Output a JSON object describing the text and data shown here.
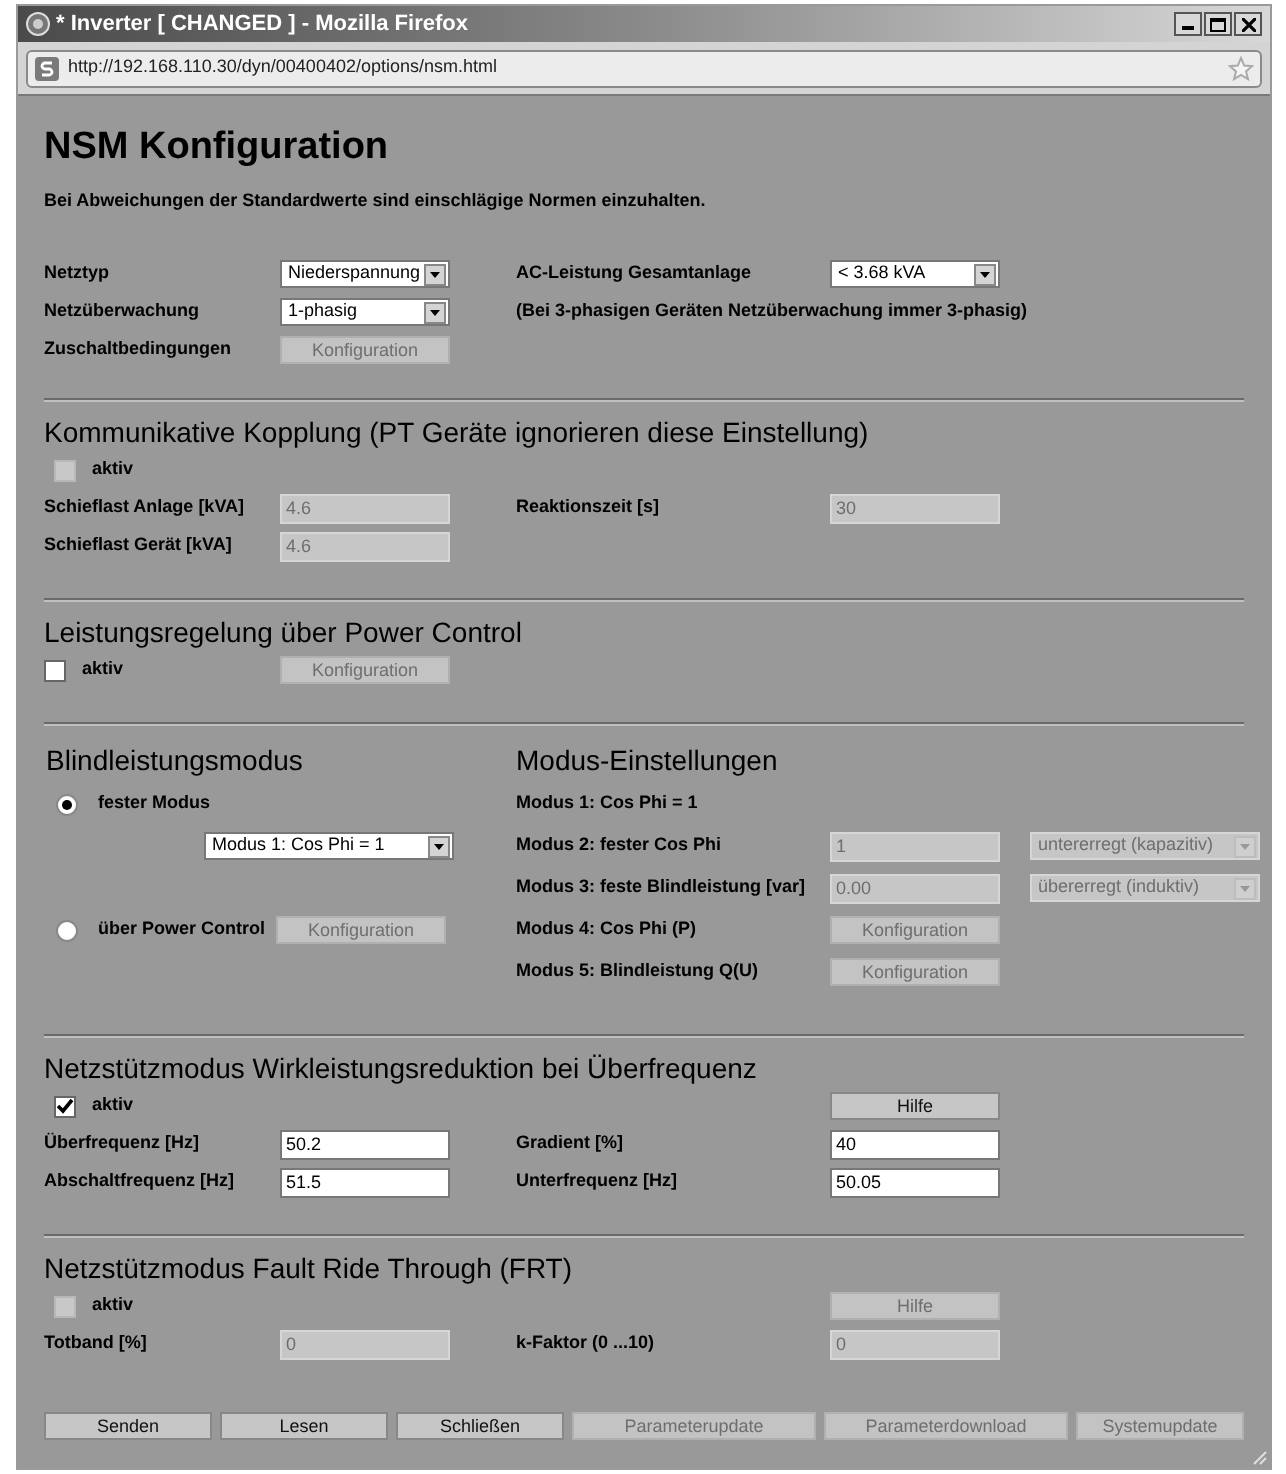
{
  "window": {
    "title": "* Inverter [ CHANGED ] - Mozilla Firefox",
    "url": "http://192.168.110.30/dyn/00400402/options/nsm.html"
  },
  "heading": "NSM Konfiguration",
  "note": "Bei Abweichungen der Standardwerte sind einschlägige Normen einzuhalten.",
  "sections": [
    {
      "kind": "plain",
      "rows": [
        {
          "kind": "field",
          "label": "Netztyp",
          "control": {
            "kind": "select",
            "value": "Niederspannung",
            "disabled": false
          },
          "label2": "AC-Leistung Gesamtanlage",
          "control2": {
            "kind": "select",
            "value": "< 3.68 kVA",
            "disabled": false
          }
        },
        {
          "kind": "field",
          "label": "Netzüberwachung",
          "control": {
            "kind": "select",
            "value": "1-phasig",
            "disabled": false
          },
          "note": "(Bei 3-phasigen Geräten Netzüberwachung immer 3-phasig)"
        },
        {
          "kind": "field",
          "label": "Zuschaltbedingungen",
          "control": {
            "kind": "button",
            "label": "Konfiguration",
            "disabled": true
          }
        }
      ]
    },
    {
      "kind": "plain",
      "title": "Kommunikative Kopplung (PT Geräte ignorieren diese Einstellung)",
      "rows": [
        {
          "kind": "check",
          "checkbox": {
            "label": "aktiv",
            "checked": false,
            "disabled": true
          }
        },
        {
          "kind": "field",
          "label": "Schieflast Anlage [kVA]",
          "control": {
            "kind": "input",
            "value": "4.6",
            "disabled": true
          },
          "label2": "Reaktionszeit [s]",
          "control2": {
            "kind": "input",
            "value": "30",
            "disabled": true
          }
        },
        {
          "kind": "field",
          "label": "Schieflast Gerät [kVA]",
          "control": {
            "kind": "input",
            "value": "4.6",
            "disabled": true
          }
        }
      ]
    },
    {
      "kind": "plain",
      "title": "Leistungsregelung über Power Control",
      "rows": [
        {
          "kind": "field",
          "checkbox": {
            "label": "aktiv",
            "checked": false,
            "disabled": false
          },
          "control": {
            "kind": "button",
            "label": "Konfiguration",
            "disabled": true
          }
        }
      ]
    },
    {
      "kind": "split",
      "left": {
        "title": "Blindleistungsmodus",
        "rows": [
          {
            "kind": "radio",
            "label": "fester Modus",
            "selected": true
          },
          {
            "kind": "select_row",
            "control": {
              "kind": "select",
              "value": "Modus 1: Cos Phi = 1",
              "disabled": false
            }
          },
          {
            "kind": "empty"
          },
          {
            "kind": "radio",
            "label": "über Power Control",
            "selected": false,
            "control": {
              "kind": "button",
              "label": "Konfiguration",
              "disabled": true
            }
          }
        ]
      },
      "right": {
        "title": "Modus-Einstellungen",
        "rows": [
          {
            "kind": "field",
            "label2": "Modus 1: Cos Phi = 1"
          },
          {
            "kind": "field",
            "label2": "Modus 2: fester Cos Phi",
            "control2": {
              "kind": "input",
              "value": "1",
              "disabled": true
            },
            "control3": {
              "kind": "select",
              "value": "untererregt (kapazitiv)",
              "disabled": true
            }
          },
          {
            "kind": "field",
            "label2": "Modus 3: feste Blindleistung [var]",
            "control2": {
              "kind": "input",
              "value": "0.00",
              "disabled": true
            },
            "control3": {
              "kind": "select",
              "value": "übererregt (induktiv)",
              "disabled": true
            }
          },
          {
            "kind": "field",
            "label2": "Modus 4: Cos Phi (P)",
            "control2": {
              "kind": "button",
              "label": "Konfiguration",
              "disabled": true
            }
          },
          {
            "kind": "field",
            "label2": "Modus 5: Blindleistung Q(U)",
            "control2": {
              "kind": "button",
              "label": "Konfiguration",
              "disabled": true
            }
          }
        ]
      }
    },
    {
      "kind": "plain",
      "title": "Netzstützmodus Wirkleistungsreduktion bei Überfrequenz",
      "rows": [
        {
          "kind": "check",
          "checkbox": {
            "label": "aktiv",
            "checked": true,
            "disabled": false
          },
          "button": {
            "kind": "button",
            "label": "Hilfe",
            "disabled": false
          }
        },
        {
          "kind": "field",
          "label": "Überfrequenz [Hz]",
          "control": {
            "kind": "input",
            "value": "50.2",
            "disabled": false
          },
          "label2": "Gradient [%]",
          "control2": {
            "kind": "input",
            "value": "40",
            "disabled": false
          }
        },
        {
          "kind": "field",
          "label": "Abschaltfrequenz [Hz]",
          "control": {
            "kind": "input",
            "value": "51.5",
            "disabled": false
          },
          "label2": "Unterfrequenz [Hz]",
          "control2": {
            "kind": "input",
            "value": "50.05",
            "disabled": false
          }
        }
      ]
    },
    {
      "kind": "plain",
      "title": "Netzstützmodus Fault Ride Through (FRT)",
      "rows": [
        {
          "kind": "check",
          "checkbox": {
            "label": "aktiv",
            "checked": false,
            "disabled": true
          },
          "button": {
            "kind": "button",
            "label": "Hilfe",
            "disabled": true
          }
        },
        {
          "kind": "field",
          "label": "Totband [%]",
          "control": {
            "kind": "input",
            "value": "0",
            "disabled": true
          },
          "label2": "k-Faktor (0 ...10)",
          "control2": {
            "kind": "input",
            "value": "0",
            "disabled": true
          }
        }
      ]
    }
  ],
  "buttons": [
    {
      "label": "Senden",
      "disabled": false
    },
    {
      "label": "Lesen",
      "disabled": false
    },
    {
      "label": "Schließen",
      "disabled": false
    },
    {
      "label": "Parameterupdate",
      "disabled": true,
      "wide": true
    },
    {
      "label": "Parameterdownload",
      "disabled": true,
      "wide": true
    },
    {
      "label": "Systemupdate",
      "disabled": true
    }
  ]
}
